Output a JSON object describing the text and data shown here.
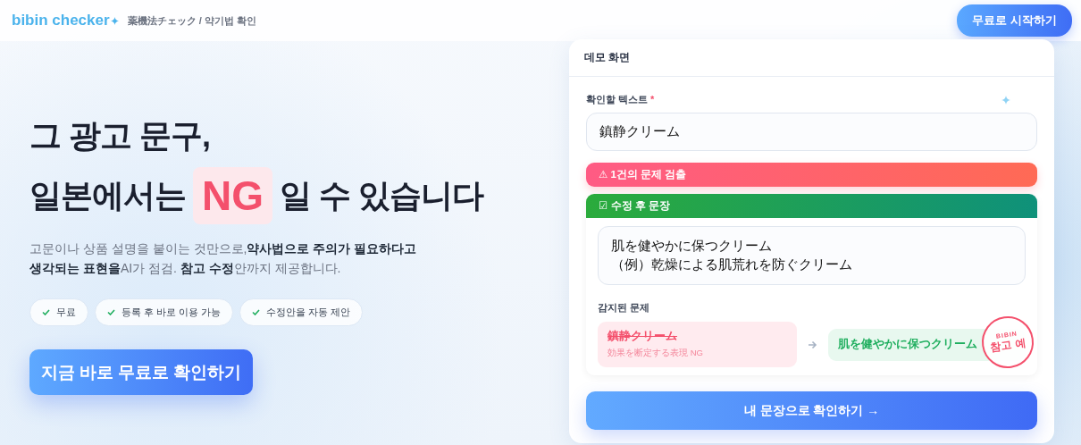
{
  "header": {
    "logo": "bibin checker",
    "subtitle": "薬機法チェック / 약기법 확인",
    "cta": "무료로 시작하기"
  },
  "hero": {
    "headline_line1": "그 광고 문구,",
    "headline_before": "일본에서는",
    "badge": "NG",
    "headline_after": "일 수 있습니다",
    "description": "고문이나 상품 설명을 붙이는 것만으로,**약사법으로 주의가 필요하다고 생각되는 표현을**AI가 점검. **참고 수정**안까지 제공합니다.",
    "features": [
      "무료",
      "등록 후 바로 이용 가능",
      "수정안을 자동 제안"
    ],
    "cta": "지금 바로 무료로 확인하기"
  },
  "demo": {
    "title": "데모 화면",
    "input_label": "확인할 텍스트",
    "required_mark": "*",
    "input_value": "鎮静クリーム",
    "alert": {
      "icon": "⚠",
      "text": "1건의 문제 검출"
    },
    "result": {
      "icon": "☑",
      "title": "수정 후 문장",
      "lines": [
        "肌を健やかに保つクリーム",
        "（例）乾燥による肌荒れを防ぐクリーム"
      ],
      "detected_label": "감지된 문제",
      "issue": {
        "original": "鎮静クリーム",
        "reason": "効果を断定する表現 NG",
        "suggestion": "肌を健やかに保つクリーム"
      },
      "stamp": {
        "brand": "BIBIN",
        "text": "참고 예"
      }
    },
    "button": {
      "text": "내 문장으로 확인하기",
      "arrow": "→"
    }
  }
}
